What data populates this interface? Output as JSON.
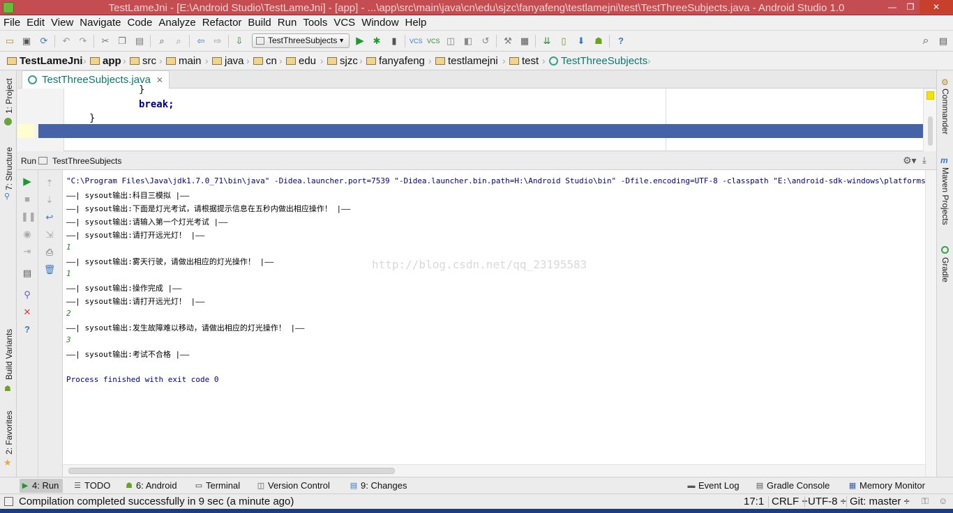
{
  "window": {
    "title": "TestLameJni - [E:\\Android Studio\\TestLameJni] - [app] - ...\\app\\src\\main\\java\\cn\\edu\\sjzc\\fanyafeng\\testlamejni\\test\\TestThreeSubjects.java - Android Studio 1.0",
    "minimize": "—",
    "restore": "❐",
    "close": "✕"
  },
  "menu": [
    "File",
    "Edit",
    "View",
    "Navigate",
    "Code",
    "Analyze",
    "Refactor",
    "Build",
    "Run",
    "Tools",
    "VCS",
    "Window",
    "Help"
  ],
  "toolbar": {
    "run_config": "TestThreeSubjects",
    "icons": [
      "open-icon",
      "save-icon",
      "sync-icon",
      "undo-icon",
      "redo-icon",
      "cut-icon",
      "copy-icon",
      "paste-icon",
      "find-icon",
      "replace-icon",
      "back-icon",
      "forward-icon",
      "make-icon",
      "run-icon",
      "debug-icon",
      "attach-icon",
      "vcs-update-icon",
      "vcs-commit-icon",
      "vcs-compare-icon",
      "vcs-history-icon",
      "vcs-revert-icon",
      "project-structure-icon",
      "sdk-manager-icon",
      "gradle-sync-icon",
      "avd-manager-icon",
      "android-device-monitor-icon",
      "help-icon"
    ]
  },
  "breadcrumbs": [
    "TestLameJni",
    "app",
    "src",
    "main",
    "java",
    "cn",
    "edu",
    "sjzc",
    "fanyafeng",
    "testlamejni",
    "test",
    "TestThreeSubjects"
  ],
  "left_tools": [
    "1: Project",
    "7: Structure",
    "Build Variants",
    "2: Favorites"
  ],
  "right_tools": [
    "Commander",
    "Maven Projects",
    "Gradle"
  ],
  "editor": {
    "tab": "TestThreeSubjects.java",
    "lines": [
      "}",
      "break;",
      "}"
    ]
  },
  "run": {
    "label": "Run",
    "config": "TestThreeSubjects",
    "console": [
      {
        "type": "cmd",
        "text": "\"C:\\Program Files\\Java\\jdk1.7.0_71\\bin\\java\" -Didea.launcher.port=7539 \"-Didea.launcher.bin.path=H:\\Android Studio\\bin\" -Dfile.encoding=UTF-8 -classpath \"E:\\android-sdk-windows\\platforms\\android-21\\android"
      },
      {
        "type": "out",
        "text": "——| sysout输出:科目三模拟 |——"
      },
      {
        "type": "out",
        "text": "——| sysout输出:下面是灯光考试，请根据提示信息在五秒内做出相应操作！ |——"
      },
      {
        "type": "out",
        "text": "——| sysout输出:请输入第一个灯光考试 |——"
      },
      {
        "type": "out",
        "text": "——| sysout输出:请打开远光灯！ |——"
      },
      {
        "type": "in",
        "text": "1"
      },
      {
        "type": "out",
        "text": "——| sysout输出:雾天行驶，请做出相应的灯光操作！ |——"
      },
      {
        "type": "in",
        "text": "1"
      },
      {
        "type": "out",
        "text": "——| sysout输出:操作完成 |——"
      },
      {
        "type": "out",
        "text": "——| sysout输出:请打开远光灯！ |——"
      },
      {
        "type": "in",
        "text": "2"
      },
      {
        "type": "out",
        "text": "——| sysout输出:发生故障难以移动，请做出相应的灯光操作！ |——"
      },
      {
        "type": "in",
        "text": "3"
      },
      {
        "type": "out",
        "text": "——| sysout输出:考试不合格 |——"
      },
      {
        "type": "blank",
        "text": ""
      },
      {
        "type": "fin",
        "text": "Process finished with exit code 0"
      }
    ],
    "watermark": "http://blog.csdn.net/qq_23195583"
  },
  "bottom_tabs": {
    "run": "4: Run",
    "todo": "TODO",
    "android": "6: Android",
    "terminal": "Terminal",
    "vcs": "Version Control",
    "changes": "9: Changes",
    "event_log": "Event Log",
    "gradle_console": "Gradle Console",
    "memory_monitor": "Memory Monitor"
  },
  "status": {
    "message": "Compilation completed successfully in 9 sec (a minute ago)",
    "position": "17:1",
    "line_sep": "CRLF ÷",
    "encoding": "UTF-8 ÷",
    "git": "Git: master ÷"
  }
}
